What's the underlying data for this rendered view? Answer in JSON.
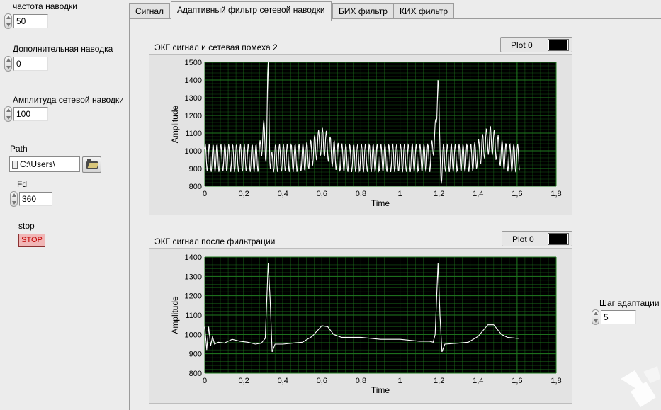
{
  "left_panel": {
    "freq_label": "частота наводки",
    "freq_value": "50",
    "extra_label": "Дополнительная наводка",
    "extra_value": "0",
    "amp_label": "Амплитуда сетевой наводки",
    "amp_value": "100",
    "path_label": "Path",
    "path_value": "C:\\Users\\",
    "fd_label": "Fd",
    "fd_value": "360",
    "stop_label": "stop",
    "stop_button": "STOP"
  },
  "tabs": [
    {
      "label": "Сигнал",
      "active": false
    },
    {
      "label": "Адаптивный фильтр сетевой наводки",
      "active": true
    },
    {
      "label": "БИХ фильтр",
      "active": false
    },
    {
      "label": "КИХ фильтр",
      "active": false
    }
  ],
  "step_control": {
    "label": "Шаг адаптации",
    "value": "5"
  },
  "colors": {
    "plot_bg": "#000000",
    "grid": "#1f7a1f",
    "trace": "#ffffff",
    "stop_bg": "#f1b6b6",
    "stop_text": "#c00000"
  },
  "icons": [
    "spinner-icon",
    "path-file-icon",
    "folder-icon",
    "legend-swatch-icon",
    "ni-logo-icon"
  ],
  "chart_data": [
    {
      "type": "line",
      "title": "ЭКГ сигнал и сетевая помеха 2",
      "legend": "Plot 0",
      "legend_position": "top-right",
      "xlabel": "Time",
      "ylabel": "Amplitude",
      "xlim": [
        0,
        1.8
      ],
      "ylim": [
        800,
        1500
      ],
      "xticks": [
        "0",
        "0,2",
        "0,4",
        "0,6",
        "0,8",
        "1",
        "1,2",
        "1,4",
        "1,6",
        "1,8"
      ],
      "yticks": [
        "800",
        "900",
        "1000",
        "1100",
        "1200",
        "1300",
        "1400",
        "1500"
      ],
      "grid": true,
      "series": [
        {
          "name": "Plot 0",
          "x_start": 0,
          "x_end": 1.61,
          "sample_rate": 360,
          "mains_hz": 50,
          "noise_amplitude": 100,
          "baseline": 960,
          "features": [
            {
              "x": 0.3,
              "y": 1120
            },
            {
              "x": 0.325,
              "y": 1440
            },
            {
              "x": 0.34,
              "y": 900
            },
            {
              "x": 0.6,
              "y": 1050
            },
            {
              "x": 1.18,
              "y": 1120
            },
            {
              "x": 1.195,
              "y": 1440
            },
            {
              "x": 1.21,
              "y": 880
            },
            {
              "x": 1.46,
              "y": 1060
            }
          ]
        }
      ]
    },
    {
      "type": "line",
      "title": "ЭКГ сигнал после фильтрации",
      "legend": "Plot 0",
      "legend_position": "top-right",
      "xlabel": "Time",
      "ylabel": "Amplitude",
      "xlim": [
        0,
        1.8
      ],
      "ylim": [
        800,
        1400
      ],
      "xticks": [
        "0",
        "0,2",
        "0,4",
        "0,6",
        "0,8",
        "1",
        "1,2",
        "1,4",
        "1,6",
        "1,8"
      ],
      "yticks": [
        "800",
        "900",
        "1000",
        "1100",
        "1200",
        "1300",
        "1400"
      ],
      "grid": true,
      "series": [
        {
          "name": "Plot 0",
          "points": [
            [
              0,
              1040
            ],
            [
              0.01,
              920
            ],
            [
              0.02,
              1040
            ],
            [
              0.03,
              940
            ],
            [
              0.04,
              990
            ],
            [
              0.05,
              950
            ],
            [
              0.07,
              960
            ],
            [
              0.1,
              955
            ],
            [
              0.14,
              975
            ],
            [
              0.18,
              965
            ],
            [
              0.22,
              960
            ],
            [
              0.26,
              950
            ],
            [
              0.29,
              955
            ],
            [
              0.31,
              980
            ],
            [
              0.325,
              1370
            ],
            [
              0.335,
              1180
            ],
            [
              0.345,
              910
            ],
            [
              0.36,
              950
            ],
            [
              0.4,
              950
            ],
            [
              0.45,
              955
            ],
            [
              0.5,
              960
            ],
            [
              0.55,
              990
            ],
            [
              0.6,
              1045
            ],
            [
              0.63,
              1040
            ],
            [
              0.66,
              1000
            ],
            [
              0.7,
              985
            ],
            [
              0.8,
              985
            ],
            [
              0.9,
              975
            ],
            [
              1.0,
              975
            ],
            [
              1.1,
              965
            ],
            [
              1.15,
              965
            ],
            [
              1.17,
              960
            ],
            [
              1.18,
              1000
            ],
            [
              1.195,
              1370
            ],
            [
              1.205,
              1100
            ],
            [
              1.215,
              910
            ],
            [
              1.23,
              950
            ],
            [
              1.3,
              955
            ],
            [
              1.35,
              960
            ],
            [
              1.4,
              990
            ],
            [
              1.45,
              1050
            ],
            [
              1.48,
              1050
            ],
            [
              1.52,
              1000
            ],
            [
              1.55,
              985
            ],
            [
              1.6,
              980
            ],
            [
              1.61,
              980
            ]
          ]
        }
      ]
    }
  ]
}
